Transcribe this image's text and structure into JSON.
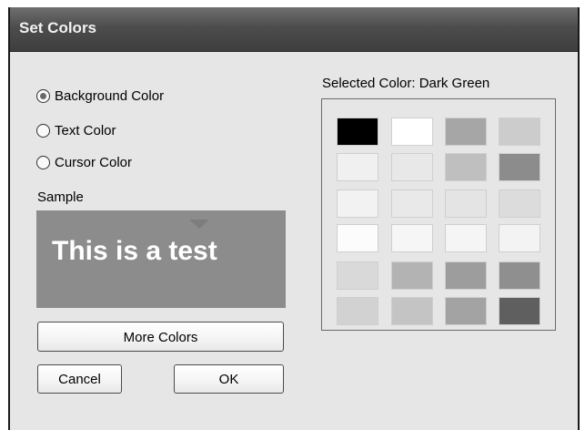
{
  "dialog": {
    "title": "Set Colors"
  },
  "radios": [
    {
      "label": "Background Color",
      "checked": true
    },
    {
      "label": "Text Color",
      "checked": false
    },
    {
      "label": "Cursor Color",
      "checked": false
    }
  ],
  "sample": {
    "label": "Sample",
    "text": "This is a test",
    "background": "#8c8c8c",
    "text_color": "#ffffff"
  },
  "buttons": {
    "more_colors": "More Colors",
    "cancel": "Cancel",
    "ok": "OK"
  },
  "palette": {
    "selected_label": "Selected Color: Dark Green",
    "rows": [
      [
        "#000000",
        "#ffffff",
        "#a6a6a6",
        "#cccccc"
      ],
      [
        "#f0f0f0",
        "#e8e8e8",
        "#bfbfbf",
        "#8c8c8c"
      ],
      [
        "#f2f2f2",
        "#e9e9e9",
        "#e4e4e4",
        "#dcdcdc"
      ],
      [
        "#fcfcfc",
        "#f6f6f6",
        "#f5f5f5",
        "#f3f3f3"
      ],
      [
        "#d9d9d9",
        "#b3b3b3",
        "#9d9d9d",
        "#8f8f8f"
      ],
      [
        "#d2d2d2",
        "#c4c4c4",
        "#a3a3a3",
        "#5f5f5f"
      ]
    ]
  }
}
